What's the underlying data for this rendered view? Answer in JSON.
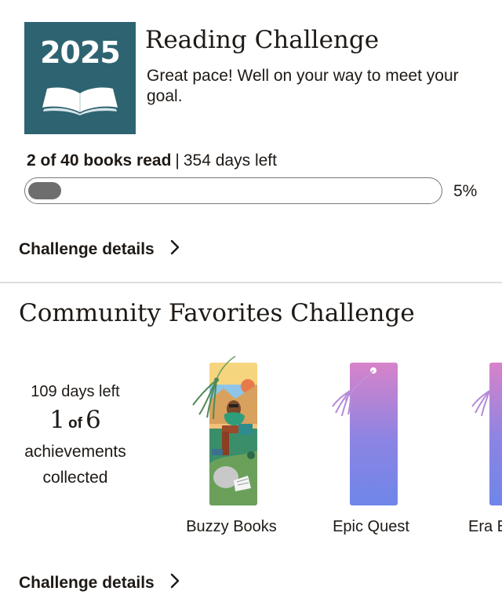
{
  "reading_challenge": {
    "year": "2025",
    "title": "Reading Challenge",
    "subtitle": "Great pace! Well on your way to meet your goal.",
    "books_read_text": "2 of 40 books read",
    "separator": "|",
    "days_left_text": "354 days left",
    "progress_fraction": 0.05,
    "percent_label": "5%",
    "details_label": "Challenge details",
    "badge_color": "#2e6471"
  },
  "community_challenge": {
    "title": "Community Favorites Challenge",
    "days_left": "109 days left",
    "collected": "1",
    "of": "of",
    "total": "6",
    "achievements_line1": "achievements",
    "achievements_line2": "collected",
    "details_label": "Challenge details",
    "bookmarks": [
      {
        "label": "Buzzy Books",
        "icon": "illustrated-bookmark"
      },
      {
        "label": "Epic Quest",
        "icon": "gradient-bookmark"
      },
      {
        "label": "Era B",
        "icon": "gradient-bookmark"
      }
    ]
  }
}
